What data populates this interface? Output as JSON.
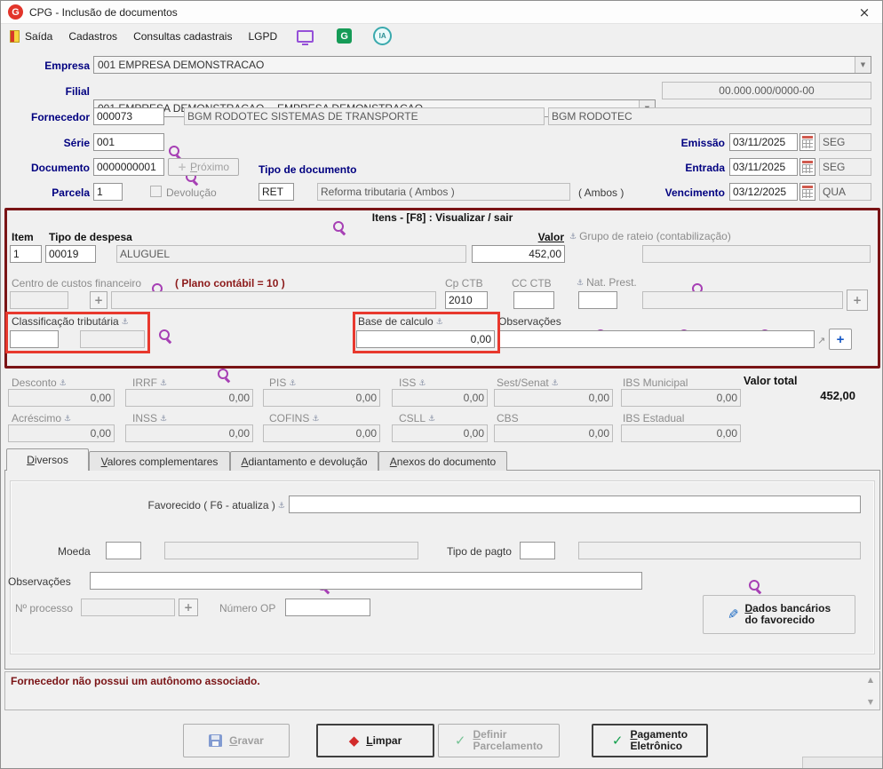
{
  "window": {
    "title": "CPG - Inclusão de documentos"
  },
  "menu": {
    "saida": "Saída",
    "cadastros": "Cadastros",
    "consultas": "Consultas cadastrais",
    "lgpd": "LGPD"
  },
  "icons": {
    "logo": "G",
    "g": "G",
    "ia": "IA",
    "close": "×",
    "dropdown": "▼",
    "anchor": "⚓",
    "plus": "+",
    "check": "✓",
    "diamond": "◆",
    "pencil": "✎",
    "expand": "↗",
    "up": "▲",
    "down": "▼"
  },
  "header": {
    "empresa_label": "Empresa",
    "empresa_value": "001 EMPRESA DEMONSTRACAO",
    "filial_label": "Filial",
    "filial_value": "001 EMPRESA DEMONSTRACAO -- EMPRESA DEMONSTRACAO",
    "filial_cnpj": "00.000.000/0000-00",
    "fornecedor_label": "Fornecedor",
    "fornecedor_code": "000073",
    "fornecedor_name": "BGM RODOTEC SISTEMAS DE TRANSPORTE",
    "fornecedor_short": "BGM RODOTEC",
    "serie_label": "Série",
    "serie_value": "001",
    "documento_label": "Documento",
    "documento_value": "0000000001",
    "proximo_label": "Próximo",
    "tipo_documento_label": "Tipo de documento",
    "tipo_documento_code": "RET",
    "tipo_documento_descr": "Reforma tributaria ( Ambos )",
    "tipo_documento_scope": "( Ambos )",
    "parcela_label": "Parcela",
    "parcela_value": "1",
    "devolucao_label": "Devolução",
    "emissao_label": "Emissão",
    "emissao_date": "03/11/2025",
    "emissao_weekday": "SEG",
    "entrada_label": "Entrada",
    "entrada_date": "03/11/2025",
    "entrada_weekday": "SEG",
    "vencimento_label": "Vencimento",
    "vencimento_date": "03/12/2025",
    "vencimento_weekday": "QUA"
  },
  "itens": {
    "title": "Itens  - [F8] : Visualizar / sair",
    "item_label": "Item",
    "item_value": "1",
    "tipo_despesa_label": "Tipo de despesa",
    "tipo_despesa_code": "00019",
    "tipo_despesa_descr": "ALUGUEL",
    "valor_label": "Valor",
    "valor_value": "452,00",
    "grupo_rateio_label": "Grupo de rateio (contabilização)",
    "grupo_rateio_value": "",
    "centro_custos_label": "Centro de custos financeiro",
    "plano_contabil": "( Plano contábil = 10 )",
    "centro_custos_value": "",
    "cp_ctb_label": "Cp CTB",
    "cp_ctb_value": "2010",
    "cc_ctb_label": "CC CTB",
    "cc_ctb_value": "",
    "nat_prest_label": "Nat. Prest.",
    "nat_prest_value": "",
    "classificacao_label": "Classificação tributária",
    "classificacao_value": "",
    "base_calculo_label": "Base de calculo",
    "base_calculo_value": "0,00",
    "observacoes_label": "Observações",
    "observacoes_value": ""
  },
  "totais": {
    "row1": [
      {
        "label": "Desconto",
        "value": "0,00"
      },
      {
        "label": "IRRF",
        "value": "0,00"
      },
      {
        "label": "PIS",
        "value": "0,00"
      },
      {
        "label": "ISS",
        "value": "0,00"
      },
      {
        "label": "Sest/Senat",
        "value": "0,00"
      },
      {
        "label": "IBS Municipal",
        "value": "0,00"
      }
    ],
    "row2": [
      {
        "label": "Acréscimo",
        "value": "0,00"
      },
      {
        "label": "INSS",
        "value": "0,00"
      },
      {
        "label": "COFINS",
        "value": "0,00"
      },
      {
        "label": "CSLL",
        "value": "0,00"
      },
      {
        "label": "CBS",
        "value": "0,00"
      },
      {
        "label": "IBS Estadual",
        "value": "0,00"
      }
    ],
    "valor_total_label": "Valor total",
    "valor_total_value": "452,00"
  },
  "tabs": [
    {
      "label": "Diversos"
    },
    {
      "label": "Valores complementares"
    },
    {
      "label": "Adiantamento e devolução"
    },
    {
      "label": "Anexos do documento"
    }
  ],
  "diversos": {
    "favorecido_label": "Favorecido ( F6 - atualiza )",
    "favorecido_value": "",
    "moeda_label": "Moeda",
    "moeda_value": "",
    "tipo_pagto_label": "Tipo de pagto",
    "tipo_pagto_value": "",
    "observacoes_label": "Observações",
    "observacoes_value": "",
    "num_processo_label": "Nº processo",
    "num_processo_value": "",
    "numero_op_label": "Número OP",
    "numero_op_value": "",
    "dados_bancarios_line1": "Dados bancários",
    "dados_bancarios_line2": "do favorecido"
  },
  "status": {
    "message": "Fornecedor não possui um autônomo associado."
  },
  "actions": {
    "gravar": "Gravar",
    "limpar": "Limpar",
    "definir_line1": "Definir",
    "definir_line2": "Parcelamento",
    "pagamento_line1": "Pagamento",
    "pagamento_line2": "Eletrônico"
  },
  "colors": {
    "itens_frame_maroon": "#7a1416",
    "highlight_red": "#e8392e",
    "label_navy": "#000080",
    "magnifier_purple": "#a63fb4",
    "check_green": "#13a04d",
    "status_maroon": "#7a1416"
  }
}
